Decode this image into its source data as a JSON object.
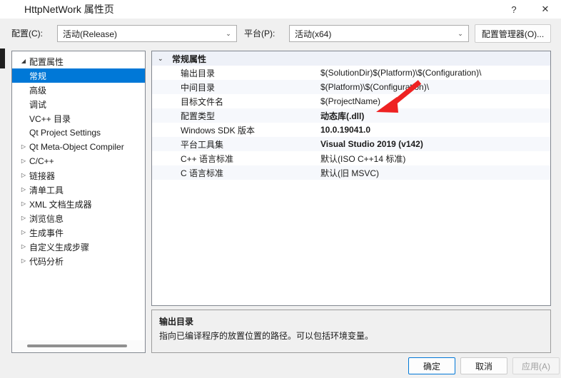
{
  "window": {
    "title": "HttpNetWork 属性页",
    "help_label": "?",
    "close_label": "✕"
  },
  "config_bar": {
    "configuration_label": "配置(C):",
    "configuration_value": "活动(Release)",
    "platform_label": "平台(P):",
    "platform_value": "活动(x64)",
    "config_manager_label": "配置管理器(O)...",
    "chevron": "⌄"
  },
  "tree": {
    "expanded_glyph": "◢",
    "collapsed_glyph": "▷",
    "items": [
      {
        "label": "配置属性",
        "level": 0,
        "twisty": "expanded",
        "selected": false
      },
      {
        "label": "常规",
        "level": 1,
        "twisty": "none",
        "selected": true
      },
      {
        "label": "高级",
        "level": 1,
        "twisty": "none",
        "selected": false
      },
      {
        "label": "调试",
        "level": 1,
        "twisty": "none",
        "selected": false
      },
      {
        "label": "VC++ 目录",
        "level": 1,
        "twisty": "none",
        "selected": false
      },
      {
        "label": "Qt Project Settings",
        "level": 1,
        "twisty": "none",
        "selected": false
      },
      {
        "label": "Qt Meta-Object Compiler",
        "level": 1,
        "twisty": "collapsed",
        "selected": false
      },
      {
        "label": "C/C++",
        "level": 1,
        "twisty": "collapsed",
        "selected": false
      },
      {
        "label": "链接器",
        "level": 1,
        "twisty": "collapsed",
        "selected": false
      },
      {
        "label": "清单工具",
        "level": 1,
        "twisty": "collapsed",
        "selected": false
      },
      {
        "label": "XML 文档生成器",
        "level": 1,
        "twisty": "collapsed",
        "selected": false
      },
      {
        "label": "浏览信息",
        "level": 1,
        "twisty": "collapsed",
        "selected": false
      },
      {
        "label": "生成事件",
        "level": 1,
        "twisty": "collapsed",
        "selected": false
      },
      {
        "label": "自定义生成步骤",
        "level": 1,
        "twisty": "collapsed",
        "selected": false
      },
      {
        "label": "代码分析",
        "level": 1,
        "twisty": "collapsed",
        "selected": false
      }
    ]
  },
  "grid": {
    "group_caret": "⌄",
    "rows": [
      {
        "name": "常规属性",
        "value": "",
        "group": true,
        "bold": false
      },
      {
        "name": "输出目录",
        "value": "$(SolutionDir)$(Platform)\\$(Configuration)\\",
        "group": false,
        "bold": false
      },
      {
        "name": "中间目录",
        "value": "$(Platform)\\$(Configuration)\\",
        "group": false,
        "bold": false
      },
      {
        "name": "目标文件名",
        "value": "$(ProjectName)",
        "group": false,
        "bold": false
      },
      {
        "name": "配置类型",
        "value": "动态库(.dll)",
        "group": false,
        "bold": true
      },
      {
        "name": "Windows SDK 版本",
        "value": "10.0.19041.0",
        "group": false,
        "bold": true
      },
      {
        "name": "平台工具集",
        "value": "Visual Studio 2019 (v142)",
        "group": false,
        "bold": true
      },
      {
        "name": "C++ 语言标准",
        "value": "默认(ISO C++14 标准)",
        "group": false,
        "bold": false
      },
      {
        "name": "C 语言标准",
        "value": "默认(旧 MSVC)",
        "group": false,
        "bold": false
      }
    ]
  },
  "description": {
    "title": "输出目录",
    "text": "指向已编译程序的放置位置的路径。可以包括环境变量。"
  },
  "footer": {
    "ok_label": "确定",
    "cancel_label": "取消",
    "apply_label": "应用(A)"
  },
  "annotation": {
    "color": "#ee2222",
    "name": "red-arrow-pointing-to-configuration-type"
  },
  "colors": {
    "accent": "#0078d7",
    "dialog_bg": "#f0f0f0",
    "panel_border": "#828790",
    "group_row_bg": "#eef1f8",
    "alt_row_bg": "#f6f8fc"
  }
}
